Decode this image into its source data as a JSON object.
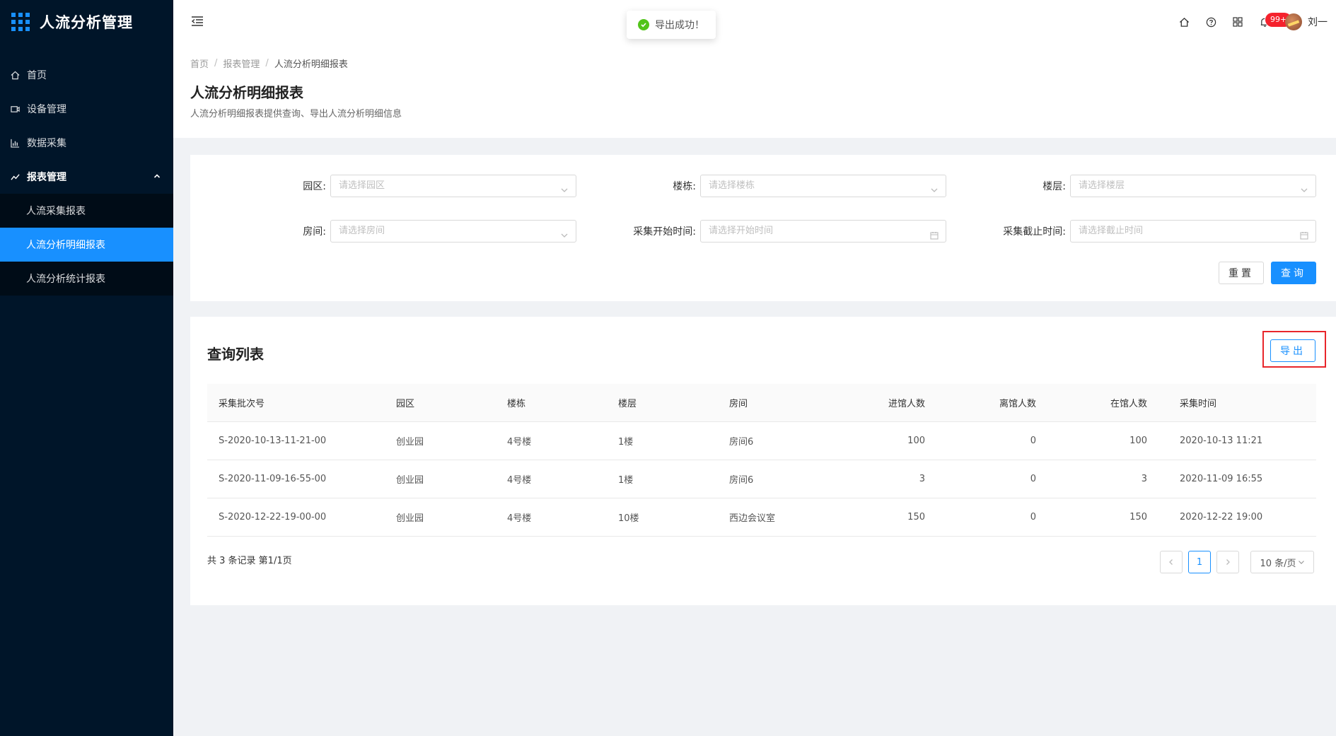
{
  "app": {
    "title": "人流分析管理"
  },
  "sidebar": {
    "items": [
      {
        "label": "首页",
        "icon": "home-icon"
      },
      {
        "label": "设备管理",
        "icon": "device-icon"
      },
      {
        "label": "数据采集",
        "icon": "bar-chart-icon"
      },
      {
        "label": "报表管理",
        "icon": "line-chart-icon"
      }
    ],
    "sub_items": [
      {
        "label": "人流采集报表",
        "active": false
      },
      {
        "label": "人流分析明细报表",
        "active": true
      },
      {
        "label": "人流分析统计报表",
        "active": false
      }
    ]
  },
  "header": {
    "badge": "99+",
    "user_name": "刘一"
  },
  "toast": {
    "message": "导出成功！"
  },
  "breadcrumb": [
    "首页",
    "报表管理",
    "人流分析明细报表"
  ],
  "page": {
    "title": "人流分析明细报表",
    "description": "人流分析明细报表提供查询、导出人流分析明细信息"
  },
  "filters": {
    "park": {
      "label": "园区:",
      "placeholder": "请选择园区"
    },
    "building": {
      "label": "楼栋:",
      "placeholder": "请选择楼栋"
    },
    "floor": {
      "label": "楼层:",
      "placeholder": "请选择楼层"
    },
    "room": {
      "label": "房间:",
      "placeholder": "请选择房间"
    },
    "start_time": {
      "label": "采集开始时间:",
      "placeholder": "请选择开始时间"
    },
    "end_time": {
      "label": "采集截止时间:",
      "placeholder": "请选择截止时间"
    },
    "reset_label": "重置",
    "query_label": "查询"
  },
  "list": {
    "title": "查询列表",
    "export_label": "导出",
    "columns": [
      "采集批次号",
      "园区",
      "楼栋",
      "楼层",
      "房间",
      "进馆人数",
      "离馆人数",
      "在馆人数",
      "采集时间"
    ],
    "rows": [
      [
        "S-2020-10-13-11-21-00",
        "创业园",
        "4号楼",
        "1楼",
        "房间6",
        "100",
        "0",
        "100",
        "2020-10-13 11:21"
      ],
      [
        "S-2020-11-09-16-55-00",
        "创业园",
        "4号楼",
        "1楼",
        "房间6",
        "3",
        "0",
        "3",
        "2020-11-09 16:55"
      ],
      [
        "S-2020-12-22-19-00-00",
        "创业园",
        "4号楼",
        "10楼",
        "西边会议室",
        "150",
        "0",
        "150",
        "2020-12-22 19:00"
      ]
    ],
    "total_text": "共 3 条记录 第1/1页",
    "current_page": "1",
    "page_size": "10 条/页"
  }
}
